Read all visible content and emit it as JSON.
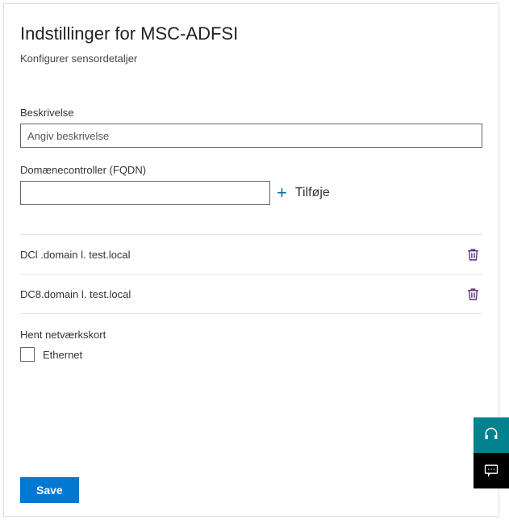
{
  "title": "Indstillinger for MSC-ADFSI",
  "subtitle": "Konfigurer sensordetaljer",
  "description": {
    "label": "Beskrivelse",
    "placeholder": "Angiv beskrivelse",
    "value": ""
  },
  "domain_controller": {
    "label": "Domænecontroller (FQDN)",
    "value": "",
    "add_label": "Tilføje"
  },
  "dc_list": [
    {
      "name": "DCl .domain l. test.local"
    },
    {
      "name": "DC8.domain l. test.local"
    }
  ],
  "network": {
    "label": "Hent netværkskort",
    "option": "Ethernet",
    "checked": false
  },
  "save_label": "Save",
  "colors": {
    "primary": "#0078d4",
    "teal": "#00838f",
    "trash": "#5b2e7e"
  }
}
